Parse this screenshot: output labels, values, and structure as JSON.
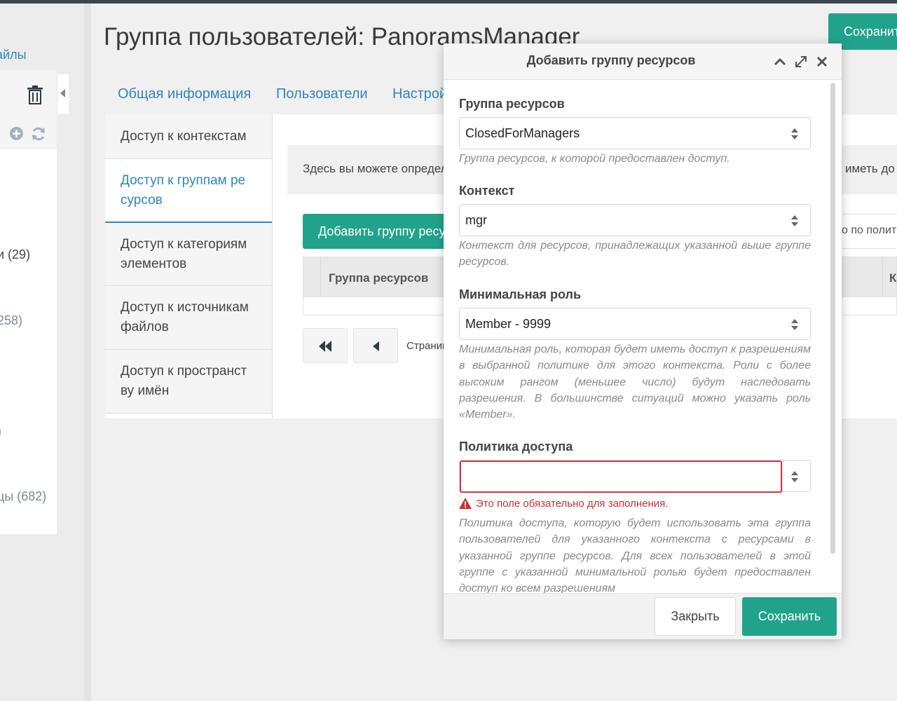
{
  "left_panel": {
    "link": "айлы",
    "tree_items": [
      "и (29)",
      "258)",
      ")",
      "цы (682)"
    ]
  },
  "page": {
    "title": "Группа пользователей: PanoramsManager",
    "save_button": "Сохранить",
    "tabs": [
      "Общая информация",
      "Пользователи",
      "Настройки"
    ]
  },
  "vertical_tabs": [
    "Доступ к контекстам",
    "Доступ к группам ре сурсов",
    "Доступ к категориям элементов",
    "Доступ к источникам файлов",
    "Доступ к пространст ву имён"
  ],
  "content": {
    "description_left": "Здесь вы можете определить",
    "description_right": "иметь до",
    "filter_placeholder": "о по полит",
    "add_button": "Добавить группу ресурсов",
    "grid_columns": [
      "Группа ресурсов",
      "К"
    ],
    "pager_label": "Страница"
  },
  "modal": {
    "title": "Добавить группу ресурсов",
    "fields": {
      "resource_group": {
        "label": "Группа ресурсов",
        "value": "ClosedForManagers",
        "help": "Группа ресурсов, к которой предоставлен доступ."
      },
      "context": {
        "label": "Контекст",
        "value": "mgr",
        "help": "Контекст для ресурсов, принадлежащих указанной выше группе ресурсов."
      },
      "min_role": {
        "label": "Минимальная роль",
        "value": "Member - 9999",
        "help": "Минимальная роль, которая будет иметь доступ к разрешениям в выбранной политике для этого контекста. Роли с более высоким рангом (меньшее число) будут наследовать разрешения. В большинстве ситуаций можно указать роль «Member»."
      },
      "policy": {
        "label": "Политика доступа",
        "value": "",
        "error": "Это поле обязательно для заполнения.",
        "help": "Политика доступа, которую будет использовать эта группа пользователей для указанного контекста с ресурсами в указанной группе ресурсов. Для всех пользователей в этой группе с указанной минимальной ролью будет предоставлен доступ ко всем разрешениям"
      }
    },
    "close_button": "Закрыть",
    "save_button": "Сохранить"
  },
  "colors": {
    "accent": "#21a38b",
    "link": "#2e86c1",
    "error": "#d33a3a"
  }
}
